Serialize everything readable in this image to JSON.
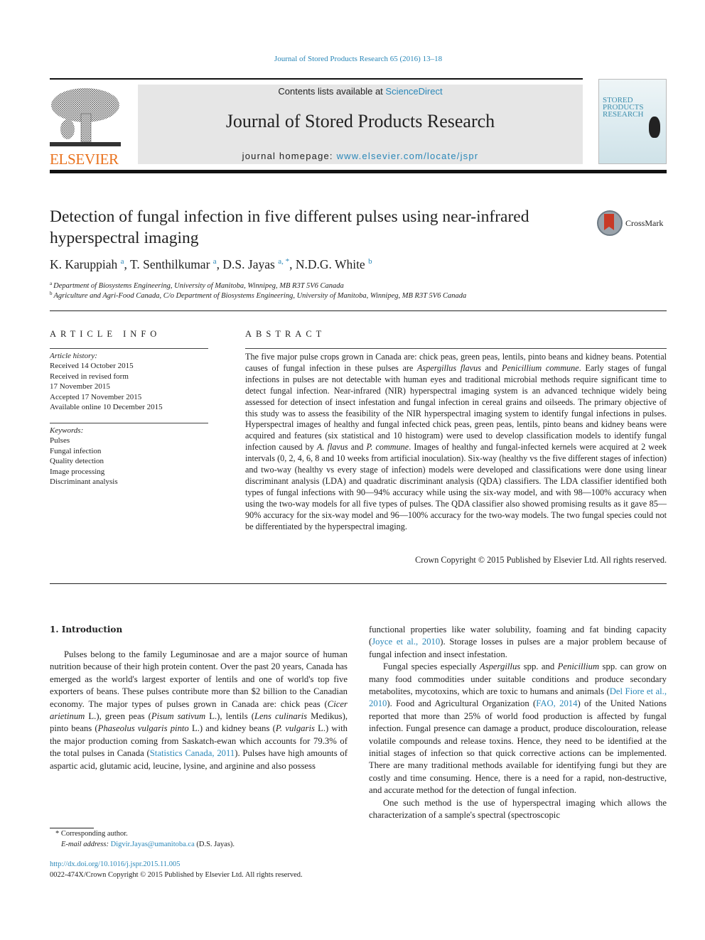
{
  "journal_ref": "Journal of Stored Products Research 65 (2016) 13–18",
  "header": {
    "publisher_logo_text": "ELSEVIER",
    "contents_prefix": "Contents lists available at ",
    "contents_link": "ScienceDirect",
    "journal_title": "Journal of Stored Products Research",
    "homepage_prefix": "journal homepage: ",
    "homepage_link": "www.elsevier.com/locate/jspr",
    "cover_title_lines": [
      "STORED",
      "PRODUCTS",
      "RESEARCH"
    ],
    "colors": {
      "link": "#2a87b8",
      "elsevier_orange": "#e9711c",
      "header_box": "#e6e6e6"
    }
  },
  "article": {
    "title": "Detection of fungal infection in five different pulses using near-infrared hyperspectral imaging",
    "crossmark_label": "CrossMark",
    "authors": [
      {
        "name": "K. Karuppiah",
        "sup": "a"
      },
      {
        "name": "T. Senthilkumar",
        "sup": "a"
      },
      {
        "name": "D.S. Jayas",
        "sup": "a, *"
      },
      {
        "name": "N.D.G. White",
        "sup": "b"
      }
    ],
    "affiliations": [
      {
        "sup": "a",
        "text": "Department of Biosystems Engineering, University of Manitoba, Winnipeg, MB R3T 5V6 Canada"
      },
      {
        "sup": "b",
        "text": "Agriculture and Agri-Food Canada, C/o Department of Biosystems Engineering, University of Manitoba, Winnipeg, MB R3T 5V6 Canada"
      }
    ]
  },
  "article_info": {
    "heading": "ARTICLE INFO",
    "history_label": "Article history:",
    "history": [
      "Received 14 October 2015",
      "Received in revised form",
      "17 November 2015",
      "Accepted 17 November 2015",
      "Available online 10 December 2015"
    ],
    "keywords_label": "Keywords:",
    "keywords": [
      "Pulses",
      "Fungal infection",
      "Quality detection",
      "Image processing",
      "Discriminant analysis"
    ]
  },
  "abstract": {
    "heading": "ABSTRACT",
    "segments": [
      {
        "t": "The five major pulse crops grown in Canada are: chick peas, green peas, lentils, pinto beans and kidney beans. Potential causes of fungal infection in these pulses are "
      },
      {
        "t": "Aspergillus flavus",
        "i": true
      },
      {
        "t": " and "
      },
      {
        "t": "Penicillium commune",
        "i": true
      },
      {
        "t": ". Early stages of fungal infections in pulses are not detectable with human eyes and traditional microbial methods require significant time to detect fungal infection. Near-infrared (NIR) hyperspectral imaging system is an advanced technique widely being assessed for detection of insect infestation and fungal infection in cereal grains and oilseeds. The primary objective of this study was to assess the feasibility of the NIR hyperspectral imaging system to identify fungal infections in pulses. Hyperspectral images of healthy and fungal infected chick peas, green peas, lentils, pinto beans and kidney beans were acquired and features (six statistical and 10 histogram) were used to develop classification models to identify fungal infection caused by "
      },
      {
        "t": "A. flavus",
        "i": true
      },
      {
        "t": " and "
      },
      {
        "t": "P. commune",
        "i": true
      },
      {
        "t": ". Images of healthy and fungal-infected kernels were acquired at 2 week intervals (0, 2, 4, 6, 8 and 10 weeks from artificial inoculation). Six-way (healthy vs the five different stages of infection) and two-way (healthy vs every stage of infection) models were developed and classifications were done using linear discriminant analysis (LDA) and quadratic discriminant analysis (QDA) classifiers. The LDA classifier identified both types of fungal infections with 90—94% accuracy while using the six-way model, and with 98—100% accuracy when using the two-way models for all five types of pulses. The QDA classifier also showed promising results as it gave 85—90% accuracy for the six-way model and 96—100% accuracy for the two-way models. The two fungal species could not be differentiated by the hyperspectral imaging."
      }
    ],
    "copyright": "Crown Copyright © 2015 Published by Elsevier Ltd. All rights reserved."
  },
  "introduction": {
    "heading": "1.  Introduction",
    "left_column": [
      [
        {
          "t": "Pulses belong to the family Leguminosae and are a major source of human nutrition because of their high protein content. Over the past 20 years, Canada has emerged as the world's largest exporter of lentils and one of world's top five exporters of beans. These pulses contribute more than $2 billion to the Canadian economy. The major types of pulses grown in Canada are: chick peas ("
        },
        {
          "t": "Cicer arietinum",
          "i": true
        },
        {
          "t": " L.), green peas ("
        },
        {
          "t": "Pisum sativum",
          "i": true
        },
        {
          "t": " L.), lentils ("
        },
        {
          "t": "Lens culinaris",
          "i": true
        },
        {
          "t": " Medikus), pinto beans ("
        },
        {
          "t": "Phaseolus vulgaris pinto",
          "i": true
        },
        {
          "t": " L.) and kidney beans ("
        },
        {
          "t": "P. vulgaris",
          "i": true
        },
        {
          "t": " L.) with the major production coming from Saskatch-ewan which accounts for 79.3% of the total pulses in Canada ("
        },
        {
          "t": "Statistics Canada, 2011",
          "link": true
        },
        {
          "t": "). Pulses have high amounts of aspartic acid, glutamic acid, leucine, lysine, and arginine and also possess"
        }
      ]
    ],
    "right_column": [
      [
        {
          "t": "functional properties like water solubility, foaming and fat binding capacity ("
        },
        {
          "t": "Joyce et al., 2010",
          "link": true
        },
        {
          "t": "). Storage losses in pulses are a major problem because of fungal infection and insect infestation."
        }
      ],
      [
        {
          "t": "Fungal species especially "
        },
        {
          "t": "Aspergillus",
          "i": true
        },
        {
          "t": " spp. and "
        },
        {
          "t": "Penicillium",
          "i": true
        },
        {
          "t": " spp. can grow on many food commodities under suitable conditions and produce secondary metabolites, mycotoxins, which are toxic to humans and animals ("
        },
        {
          "t": "Del Fiore et al., 2010",
          "link": true
        },
        {
          "t": "). Food and Agricultural Organization ("
        },
        {
          "t": "FAO, 2014",
          "link": true
        },
        {
          "t": ") of the United Nations reported that more than 25% of world food production is affected by fungal infection. Fungal presence can damage a product, produce discolouration, release volatile compounds and release toxins. Hence, they need to be identified at the initial stages of infection so that quick corrective actions can be implemented. There are many traditional methods available for identifying fungi but they are costly and time consuming. Hence, there is a need for a rapid, non-destructive, and accurate method for the detection of fungal infection."
        }
      ],
      [
        {
          "t": "One such method is the use of hyperspectral imaging which allows the characterization of a sample's spectral (spectroscopic"
        }
      ]
    ]
  },
  "footnote": {
    "corresponding": "* Corresponding author.",
    "email_label": "E-mail address: ",
    "email": "Digvir.Jayas@umanitoba.ca",
    "email_suffix": " (D.S. Jayas).",
    "doi": "http://dx.doi.org/10.1016/j.jspr.2015.11.005",
    "issn_line": "0022-474X/Crown Copyright © 2015 Published by Elsevier Ltd. All rights reserved."
  }
}
